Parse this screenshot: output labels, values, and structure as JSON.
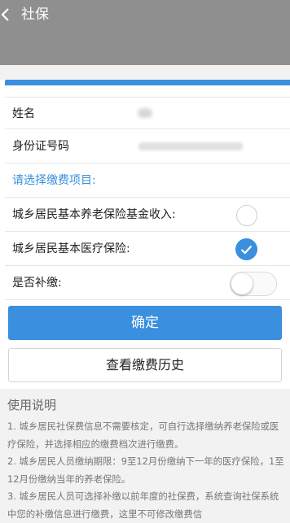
{
  "header": {
    "title": "社保"
  },
  "form": {
    "name_label": "姓名",
    "id_label": "身份证号码",
    "prompt": "请选择缴费项目:",
    "option1_label": "城乡居民基本养老保险基金收入:",
    "option1_checked": false,
    "option2_label": "城乡居民基本医疗保险:",
    "option2_checked": true,
    "makeup_label": "是否补缴:",
    "makeup_on": false
  },
  "buttons": {
    "confirm": "确定",
    "history": "查看缴费历史"
  },
  "instructions": {
    "title": "使用说明",
    "lines": [
      "1. 城乡居民社保费信息不需要核定，可自行选择缴纳养老保险或医疗保险，并选择相应的缴费档次进行缴费。",
      "2. 城乡居民人员缴纳期限：9至12月份缴纳下一年的医疗保险，1至12月份缴纳当年的养老保险。",
      "3. 城乡居民人员可选择补缴以前年度的社保费，系统查询社保系统中您的补缴信息进行缴费，这里不可修改缴费信"
    ]
  },
  "colors": {
    "accent": "#3a8fde",
    "header": "#8f8f8f"
  }
}
